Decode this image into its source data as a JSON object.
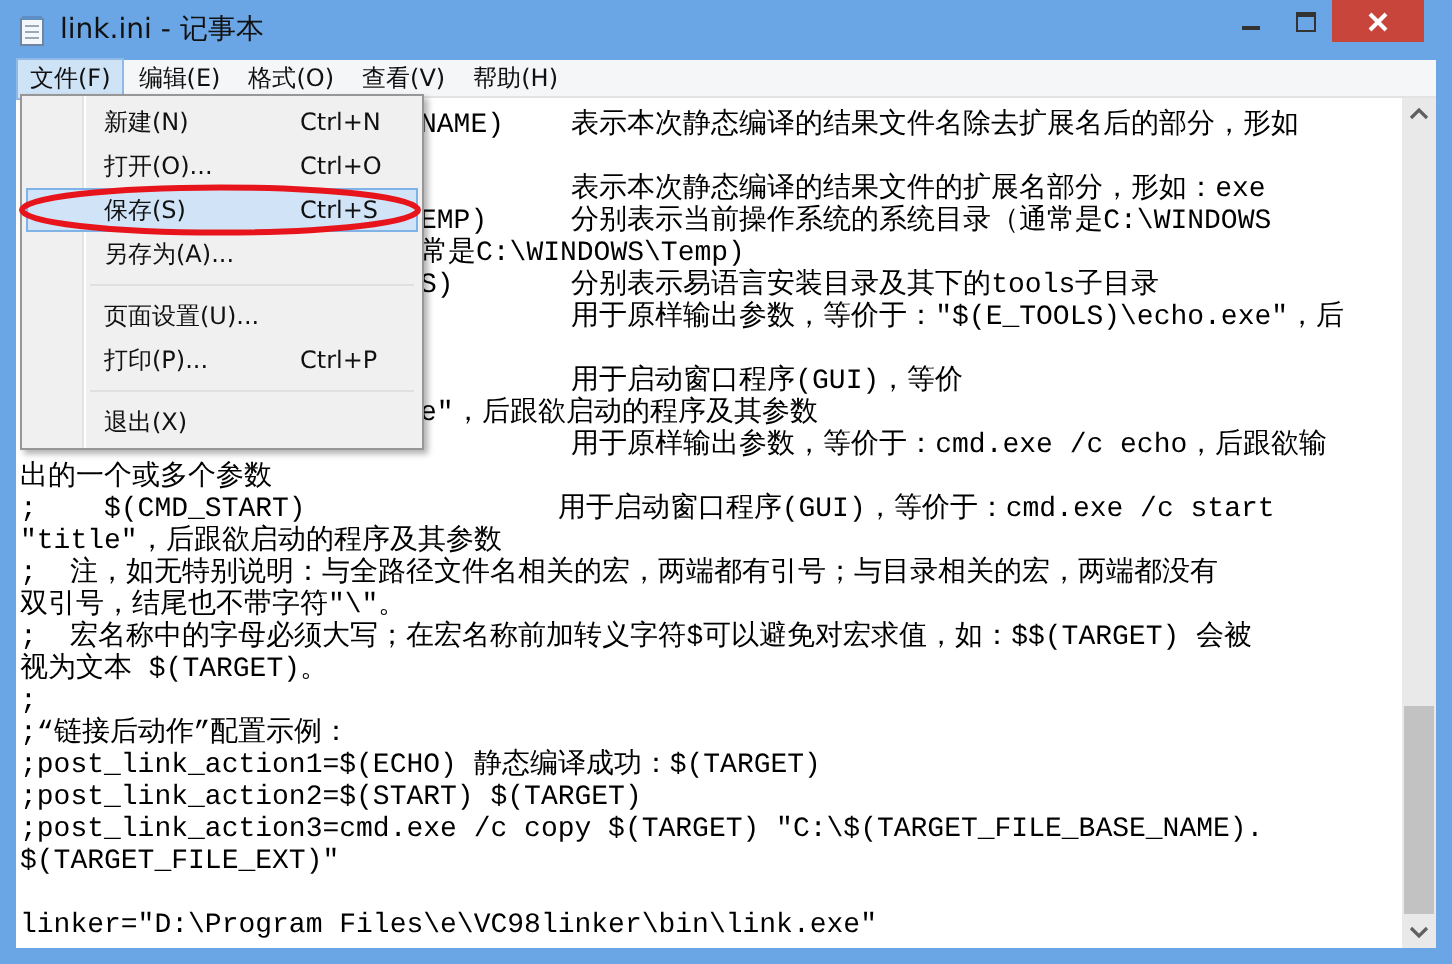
{
  "window": {
    "title": "link.ini - 记事本"
  },
  "menu_bar": [
    {
      "label": "文件(F)",
      "selected": true
    },
    {
      "label": "编辑(E)",
      "selected": false
    },
    {
      "label": "格式(O)",
      "selected": false
    },
    {
      "label": "查看(V)",
      "selected": false
    },
    {
      "label": "帮助(H)",
      "selected": false
    }
  ],
  "file_menu": {
    "items": [
      {
        "kind": "item",
        "label": "新建(N)",
        "shortcut": "Ctrl+N",
        "selected": false
      },
      {
        "kind": "item",
        "label": "打开(O)...",
        "shortcut": "Ctrl+O",
        "selected": false
      },
      {
        "kind": "item",
        "label": "保存(S)",
        "shortcut": "Ctrl+S",
        "selected": true
      },
      {
        "kind": "item",
        "label": "另存为(A)...",
        "selected": false
      },
      {
        "kind": "separator"
      },
      {
        "kind": "item",
        "label": "页面设置(U)...",
        "selected": false
      },
      {
        "kind": "item",
        "label": "打印(P)...",
        "shortcut": "Ctrl+P",
        "selected": false
      },
      {
        "kind": "separator"
      },
      {
        "kind": "item",
        "label": "退出(X)",
        "selected": false
      }
    ]
  },
  "editor": {
    "lines": [
      {
        "kind": "partial",
        "text": "NAME)    表示本次静态编译的结果文件名除去扩展名后的部分，形如"
      },
      {
        "kind": "blank"
      },
      {
        "kind": "partial",
        "text": "         表示本次静态编译的结果文件的扩展名部分，形如：exe"
      },
      {
        "kind": "partial",
        "text": "EMP)     分别表示当前操作系统的系统目录（通常是C:\\WINDOWS"
      },
      {
        "kind": "partial",
        "text": "常是C:\\WINDOWS\\Temp)"
      },
      {
        "kind": "partial",
        "text": "S)       分别表示易语言安装目录及其下的tools子目录"
      },
      {
        "kind": "partial",
        "text": "         用于原样输出参数，等价于：\"$(E_TOOLS)\\echo.exe\"，后"
      },
      {
        "kind": "blank"
      },
      {
        "kind": "partial",
        "text": "         用于启动窗口程序(GUI)，等价"
      },
      {
        "kind": "partial",
        "text": "e\"，后跟欲启动的程序及其参数"
      },
      {
        "kind": "partial",
        "text": "         用于原样输出参数，等价于：cmd.exe /c echo，后跟欲输"
      },
      {
        "kind": "text",
        "text": "出的一个或多个参数"
      },
      {
        "kind": "text",
        "text": ";    $(CMD_START)               用于启动窗口程序(GUI)，等价于：cmd.exe /c start"
      },
      {
        "kind": "text",
        "text": "\"title\"，后跟欲启动的程序及其参数"
      },
      {
        "kind": "text",
        "text": ";  注，如无特别说明：与全路径文件名相关的宏，两端都有引号；与目录相关的宏，两端都没有"
      },
      {
        "kind": "text",
        "text": "双引号，结尾也不带字符\"\\\"。"
      },
      {
        "kind": "text",
        "text": ";  宏名称中的字母必须大写；在宏名称前加转义字符$可以避免对宏求值，如：$$(TARGET) 会被"
      },
      {
        "kind": "text",
        "text": "视为文本 $(TARGET)。"
      },
      {
        "kind": "text",
        "text": ";"
      },
      {
        "kind": "text",
        "text": ";“链接后动作”配置示例："
      },
      {
        "kind": "text",
        "text": ";post_link_action1=$(ECHO) 静态编译成功：$(TARGET)"
      },
      {
        "kind": "text",
        "text": ";post_link_action2=$(START) $(TARGET)"
      },
      {
        "kind": "text",
        "text": ";post_link_action3=cmd.exe /c copy $(TARGET) \"C:\\$(TARGET_FILE_BASE_NAME)."
      },
      {
        "kind": "text",
        "text": "$(TARGET_FILE_EXT)\""
      },
      {
        "kind": "blank"
      },
      {
        "kind": "text",
        "text": "linker=\"D:\\Program Files\\e\\VC98linker\\bin\\link.exe\""
      }
    ]
  }
}
